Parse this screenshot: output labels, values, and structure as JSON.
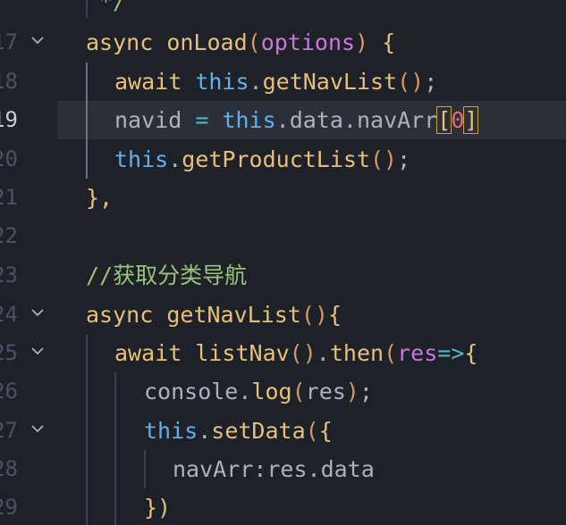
{
  "editor": {
    "lines": [
      {
        "num": "",
        "tokens": [
          {
            "t": " */",
            "c": "comment"
          }
        ],
        "indent": 96,
        "fold": false
      },
      {
        "num": "17",
        "tokens": [
          {
            "t": "async ",
            "c": "async"
          },
          {
            "t": "onLoad",
            "c": "fn"
          },
          {
            "t": "(",
            "c": "paren"
          },
          {
            "t": "options",
            "c": "param"
          },
          {
            "t": ")",
            "c": "paren"
          },
          {
            "t": " {",
            "c": "brace"
          }
        ],
        "indent": 96,
        "fold": true
      },
      {
        "num": "18",
        "tokens": [
          {
            "t": "await ",
            "c": "async"
          },
          {
            "t": "this",
            "c": "this"
          },
          {
            "t": ".",
            "c": "punc"
          },
          {
            "t": "getNavList",
            "c": "method"
          },
          {
            "t": "()",
            "c": "paren"
          },
          {
            "t": ";",
            "c": "punc"
          }
        ],
        "indent": 128,
        "fold": false
      },
      {
        "num": "19",
        "tokens": [
          {
            "t": "navid ",
            "c": "var"
          },
          {
            "t": "=",
            "c": "op"
          },
          {
            "t": " ",
            "c": "punc"
          },
          {
            "t": "this",
            "c": "this"
          },
          {
            "t": ".data.navArr",
            "c": "prop"
          },
          {
            "t": "[",
            "c": "brace"
          },
          {
            "t": "0",
            "c": "num"
          },
          {
            "t": "]",
            "c": "brace"
          }
        ],
        "indent": 128,
        "fold": false,
        "active": true
      },
      {
        "num": "20",
        "tokens": [
          {
            "t": "this",
            "c": "this"
          },
          {
            "t": ".",
            "c": "punc"
          },
          {
            "t": "getProductList",
            "c": "method"
          },
          {
            "t": "()",
            "c": "paren"
          },
          {
            "t": ";",
            "c": "punc"
          }
        ],
        "indent": 128,
        "fold": false
      },
      {
        "num": "21",
        "tokens": [
          {
            "t": "},",
            "c": "brace"
          }
        ],
        "indent": 96,
        "fold": false
      },
      {
        "num": "22",
        "tokens": [],
        "indent": 96,
        "fold": false
      },
      {
        "num": "23",
        "tokens": [
          {
            "t": "//获取分类导航",
            "c": "comment"
          }
        ],
        "indent": 96,
        "fold": false
      },
      {
        "num": "24",
        "tokens": [
          {
            "t": "async ",
            "c": "async"
          },
          {
            "t": "getNavList",
            "c": "fn"
          },
          {
            "t": "()",
            "c": "paren"
          },
          {
            "t": "{",
            "c": "brace"
          }
        ],
        "indent": 96,
        "fold": true
      },
      {
        "num": "25",
        "tokens": [
          {
            "t": "await ",
            "c": "async"
          },
          {
            "t": "listNav",
            "c": "fn"
          },
          {
            "t": "()",
            "c": "paren"
          },
          {
            "t": ".",
            "c": "punc"
          },
          {
            "t": "then",
            "c": "method"
          },
          {
            "t": "(",
            "c": "paren"
          },
          {
            "t": "res",
            "c": "param"
          },
          {
            "t": "=>",
            "c": "op"
          },
          {
            "t": "{",
            "c": "brace"
          }
        ],
        "indent": 128,
        "fold": true
      },
      {
        "num": "26",
        "tokens": [
          {
            "t": "console",
            "c": "var"
          },
          {
            "t": ".",
            "c": "punc"
          },
          {
            "t": "log",
            "c": "method"
          },
          {
            "t": "(",
            "c": "paren"
          },
          {
            "t": "res",
            "c": "var"
          },
          {
            "t": ")",
            "c": "paren"
          },
          {
            "t": ";",
            "c": "punc"
          }
        ],
        "indent": 161,
        "fold": false
      },
      {
        "num": "27",
        "tokens": [
          {
            "t": "this",
            "c": "this"
          },
          {
            "t": ".",
            "c": "punc"
          },
          {
            "t": "setData",
            "c": "method"
          },
          {
            "t": "(",
            "c": "paren"
          },
          {
            "t": "{",
            "c": "brace"
          }
        ],
        "indent": 161,
        "fold": true
      },
      {
        "num": "28",
        "tokens": [
          {
            "t": "navArr",
            "c": "var"
          },
          {
            "t": ":",
            "c": "punc"
          },
          {
            "t": "res",
            "c": "var"
          },
          {
            "t": ".data",
            "c": "prop"
          }
        ],
        "indent": 193,
        "fold": false
      },
      {
        "num": "29",
        "tokens": [
          {
            "t": "})",
            "c": "brace"
          }
        ],
        "indent": 161,
        "fold": false
      }
    ]
  },
  "colors": {
    "background": "#1f2128",
    "active_line": "#2b2f38",
    "keyword": "#e5c07b",
    "this": "#61afef",
    "param": "#c678dd",
    "comment": "#98c379",
    "number": "#e06c75"
  }
}
